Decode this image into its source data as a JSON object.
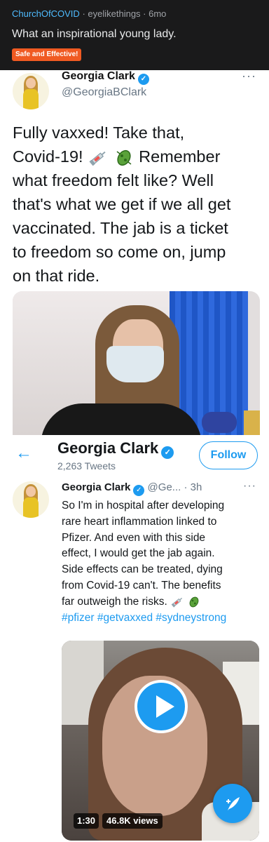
{
  "reddit": {
    "subreddit": "ChurchOfCOVID",
    "user": "eyelikethings",
    "age": "6mo",
    "title": "What an inspirational young lady.",
    "flair": "Safe and Effective!"
  },
  "tweet1": {
    "name": "Georgia Clark",
    "handle": "@GeorgiaBClark",
    "lines": [
      "Fully vaxxed! Take that,",
      "Covid-19!",
      "Remember",
      "what freedom felt like? Well",
      "that's what we get if we all get",
      "vaccinated. The jab is a ticket",
      "to freedom so come on, jump",
      "on that ride."
    ],
    "more": "···"
  },
  "profile": {
    "name": "Georgia Clark",
    "tweets": "2,263 Tweets",
    "follow_label": "Follow",
    "back": "←"
  },
  "tweet2": {
    "name": "Georgia Clark",
    "handle_time": "@Ge... · 3h",
    "lines": [
      "So I'm in hospital after developing",
      "rare heart inflammation linked to",
      "Pfizer. And even with this side",
      "effect, I would get the jab again.",
      "Side effects can be treated, dying",
      "from Covid-19 can't. The benefits",
      "far outweigh the risks."
    ],
    "hashtags": "#pfizer #getvaxxed #sydneystrong",
    "video_time": "1:30",
    "video_views": "46.8K views",
    "more": "···"
  },
  "icons": {
    "verified": "verified-badge-icon",
    "syringe": "syringe-icon",
    "microbe": "microbe-icon",
    "compose": "compose-tweet-icon"
  },
  "colors": {
    "twitter_blue": "#1d9bf0",
    "reddit_dark": "#1a1a1b",
    "flair_orange": "#f05a22"
  }
}
